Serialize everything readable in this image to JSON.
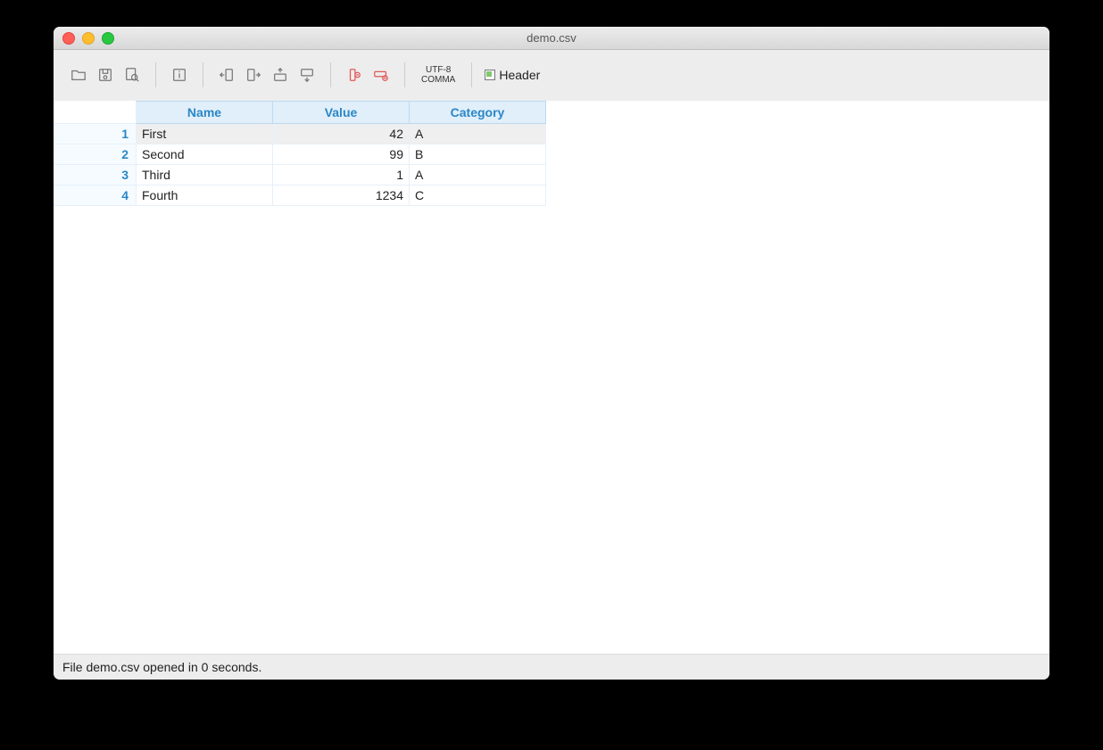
{
  "window": {
    "title": "demo.csv"
  },
  "toolbar": {
    "encoding_line1": "UTF-8",
    "encoding_line2": "COMMA",
    "header_label": "Header"
  },
  "table": {
    "columns": [
      "Name",
      "Value",
      "Category"
    ],
    "column_types": [
      "txt",
      "num",
      "txt"
    ],
    "rows": [
      {
        "num": "1",
        "cells": [
          "First",
          "42",
          "A"
        ],
        "selected": true
      },
      {
        "num": "2",
        "cells": [
          "Second",
          "99",
          "B"
        ],
        "selected": false
      },
      {
        "num": "3",
        "cells": [
          "Third",
          "1",
          "A"
        ],
        "selected": false
      },
      {
        "num": "4",
        "cells": [
          "Fourth",
          "1234",
          "C"
        ],
        "selected": false
      }
    ]
  },
  "status": {
    "text": "File demo.csv opened in 0 seconds."
  }
}
